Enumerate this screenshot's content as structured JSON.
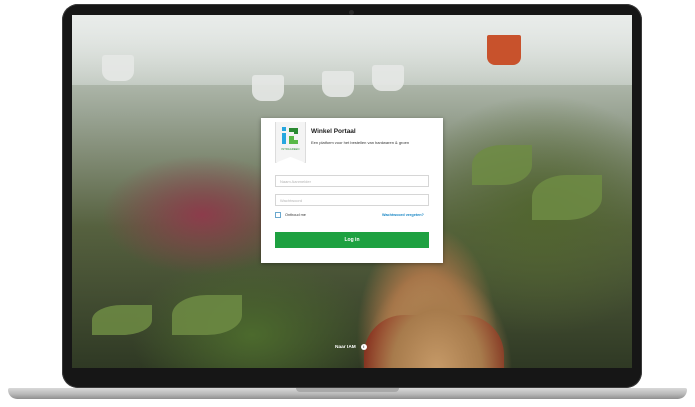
{
  "brand": {
    "logo_icon": "leaf-arrows-logo-icon",
    "logo_subtext": "INTRAGREEN",
    "accent_color": "#1ea141",
    "link_color": "#1a87c5"
  },
  "login": {
    "title": "Winkel Portaal",
    "subtitle": "Een platform voor het bestellen van hardwaren & groen",
    "username_placeholder": "Naam Aanmelder",
    "password_placeholder": "Wachtwoord",
    "remember_label": "Onthoud me",
    "forgot_label": "Wachtwoord vergeten?",
    "submit_label": "Log in"
  },
  "footer": {
    "iam_label": "Naar IAM",
    "iam_icon": "info-circle-icon"
  }
}
